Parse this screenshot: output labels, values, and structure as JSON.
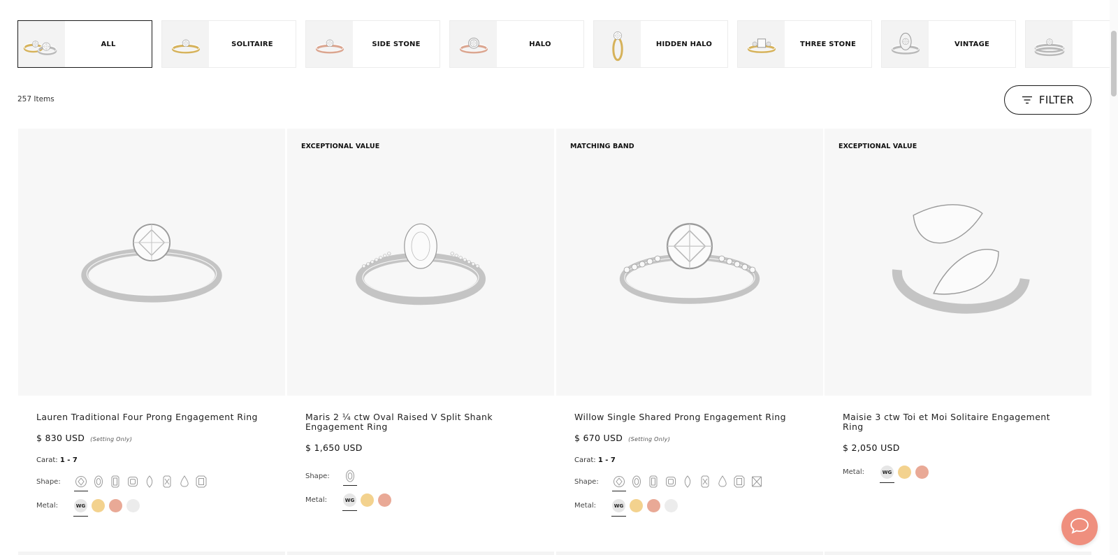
{
  "categories": [
    {
      "label": "ALL",
      "active": true,
      "icon": "ring-collection-thumbnail"
    },
    {
      "label": "SOLITAIRE",
      "active": false,
      "icon": "solitaire-ring-thumbnail"
    },
    {
      "label": "SIDE STONE",
      "active": false,
      "icon": "side-stone-ring-thumbnail"
    },
    {
      "label": "HALO",
      "active": false,
      "icon": "halo-ring-thumbnail"
    },
    {
      "label": "HIDDEN HALO",
      "active": false,
      "icon": "hidden-halo-ring-thumbnail"
    },
    {
      "label": "THREE STONE",
      "active": false,
      "icon": "three-stone-ring-thumbnail"
    },
    {
      "label": "VINTAGE",
      "active": false,
      "icon": "vintage-ring-thumbnail"
    },
    {
      "label": "",
      "active": false,
      "icon": "bridal-set-ring-thumbnail"
    }
  ],
  "items_count": "257 Items",
  "filter_label": "FILTER",
  "labels": {
    "carat": "Carat:",
    "shape": "Shape:",
    "metal": "Metal:"
  },
  "colors": {
    "white_gold": "#e6e6e6",
    "yellow_gold": "#f3d28e",
    "rose_gold": "#e9a996",
    "platinum": "#ececec",
    "chat": "#ef8f7e"
  },
  "products": [
    {
      "badge": "",
      "name": "Lauren Traditional Four Prong Engagement Ring",
      "price": "$ 830 USD",
      "price_note": "(Setting Only)",
      "carat": "1 - 7",
      "shapes": [
        "round",
        "oval",
        "emerald",
        "cushion",
        "marquise",
        "radiant",
        "pear",
        "asscher"
      ],
      "metals": [
        "WG",
        "YG",
        "RG",
        "PT"
      ],
      "image": "solitaire-four-prong-ring"
    },
    {
      "badge": "EXCEPTIONAL VALUE",
      "name": "Maris 2 ¼ ctw Oval Raised V Split Shank Engagement Ring",
      "price": "$ 1,650 USD",
      "price_note": "",
      "carat": "",
      "shapes": [
        "oval"
      ],
      "metals": [
        "WG",
        "YG",
        "RG"
      ],
      "image": "oval-split-shank-ring"
    },
    {
      "badge": "MATCHING BAND",
      "name": "Willow Single Shared Prong Engagement Ring",
      "price": "$ 670 USD",
      "price_note": "(Setting Only)",
      "carat": "1 - 7",
      "shapes": [
        "round",
        "oval",
        "emerald",
        "cushion",
        "marquise",
        "radiant",
        "pear",
        "asscher",
        "princess"
      ],
      "metals": [
        "WG",
        "YG",
        "RG",
        "PT"
      ],
      "image": "shared-prong-side-stone-ring"
    },
    {
      "badge": "EXCEPTIONAL VALUE",
      "name": "Maisie 3 ctw Toi et Moi Solitaire Engagement Ring",
      "price": "$ 2,050 USD",
      "price_note": "",
      "carat": "",
      "shapes": [],
      "metals": [
        "WG",
        "YG",
        "RG"
      ],
      "image": "toi-et-moi-pear-ring"
    }
  ]
}
